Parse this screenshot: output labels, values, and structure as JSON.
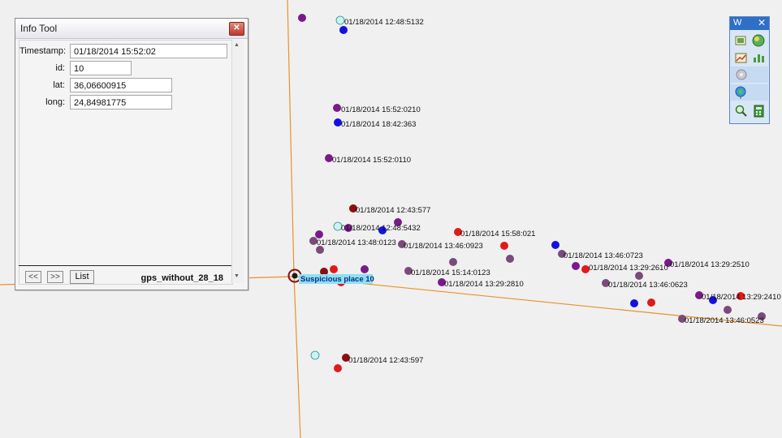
{
  "info_tool": {
    "title": "Info Tool",
    "close_glyph": "✕",
    "fields": [
      {
        "label": "Timestamp:",
        "value": "01/18/2014 15:52:02"
      },
      {
        "label": "id:",
        "value": "10"
      },
      {
        "label": "lat:",
        "value": "36,06600915"
      },
      {
        "label": "long:",
        "value": "24,84981775"
      }
    ],
    "prev_glyph": "<<",
    "next_glyph": ">>",
    "list_label": "List",
    "layer_name": "gps_without_28_18"
  },
  "w_toolbar": {
    "title": "W",
    "close_glyph": "✕",
    "tools": [
      "picture-icon",
      "globe-icon",
      "chart-icon",
      "graph-icon",
      "disc-icon",
      "globe-pin-icon",
      "magnifier-icon",
      "calculator-icon"
    ]
  },
  "map": {
    "colors": {
      "background": "#f0f0f0",
      "road": "#e8922a",
      "blue": "#1212e0",
      "purple": "#7a1a8a",
      "mauve": "#7a4a7a",
      "red": "#e01a1a",
      "darkred": "#8a0e0e",
      "cyan": "#c8f4f4"
    },
    "special_label": "Suspicious place 10",
    "labels": [
      "01/18/2014 12:48:5132",
      "01/18/2014 15:52:0210",
      "01/18/2014 18:42:363",
      "01/18/2014 15:52:0110",
      "01/18/2014 12:43:577",
      "01/18/2014 12:48:5432",
      "01/18/2014 13:48:0123",
      "01/18/2014 13:46:0923",
      "01/18/2014 15:58:021",
      "01/18/2014 13:46:0723",
      "01/18/2014 13:29:2610",
      "01/18/2014 13:29:2510",
      "01/18/2014 15:14:0123",
      "01/18/2014 13:29:2810",
      "01/18/2014 13:46:0623",
      "01/18/2014 13:29:2410",
      "01/18/2014 13:46:0523",
      "01/18/2014 12:43:597"
    ]
  }
}
